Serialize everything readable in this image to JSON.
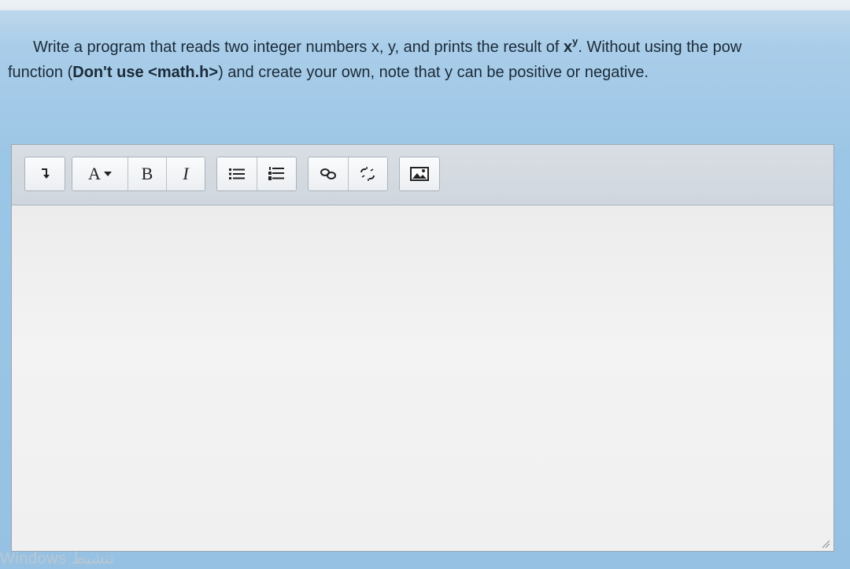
{
  "question": {
    "part1": "Write a program that reads two integer numbers x, y, and prints the result of ",
    "base": "x",
    "exponent": "y",
    "part2": ". Without using the pow",
    "part3": "function (",
    "bold_text": "Don't use <math.h>",
    "part4": ") and create your own, note that y can be positive or negative."
  },
  "toolbar": {
    "font_color_label": "A",
    "bold_label": "B",
    "italic_label": "I",
    "icons": [
      "expand-icon",
      "font-color-icon",
      "bold-icon",
      "italic-icon",
      "bullet-list-icon",
      "numbered-list-icon",
      "link-icon",
      "unlink-icon",
      "image-icon"
    ]
  },
  "editor": {
    "content": ""
  },
  "watermark": "Windows تنشيط"
}
